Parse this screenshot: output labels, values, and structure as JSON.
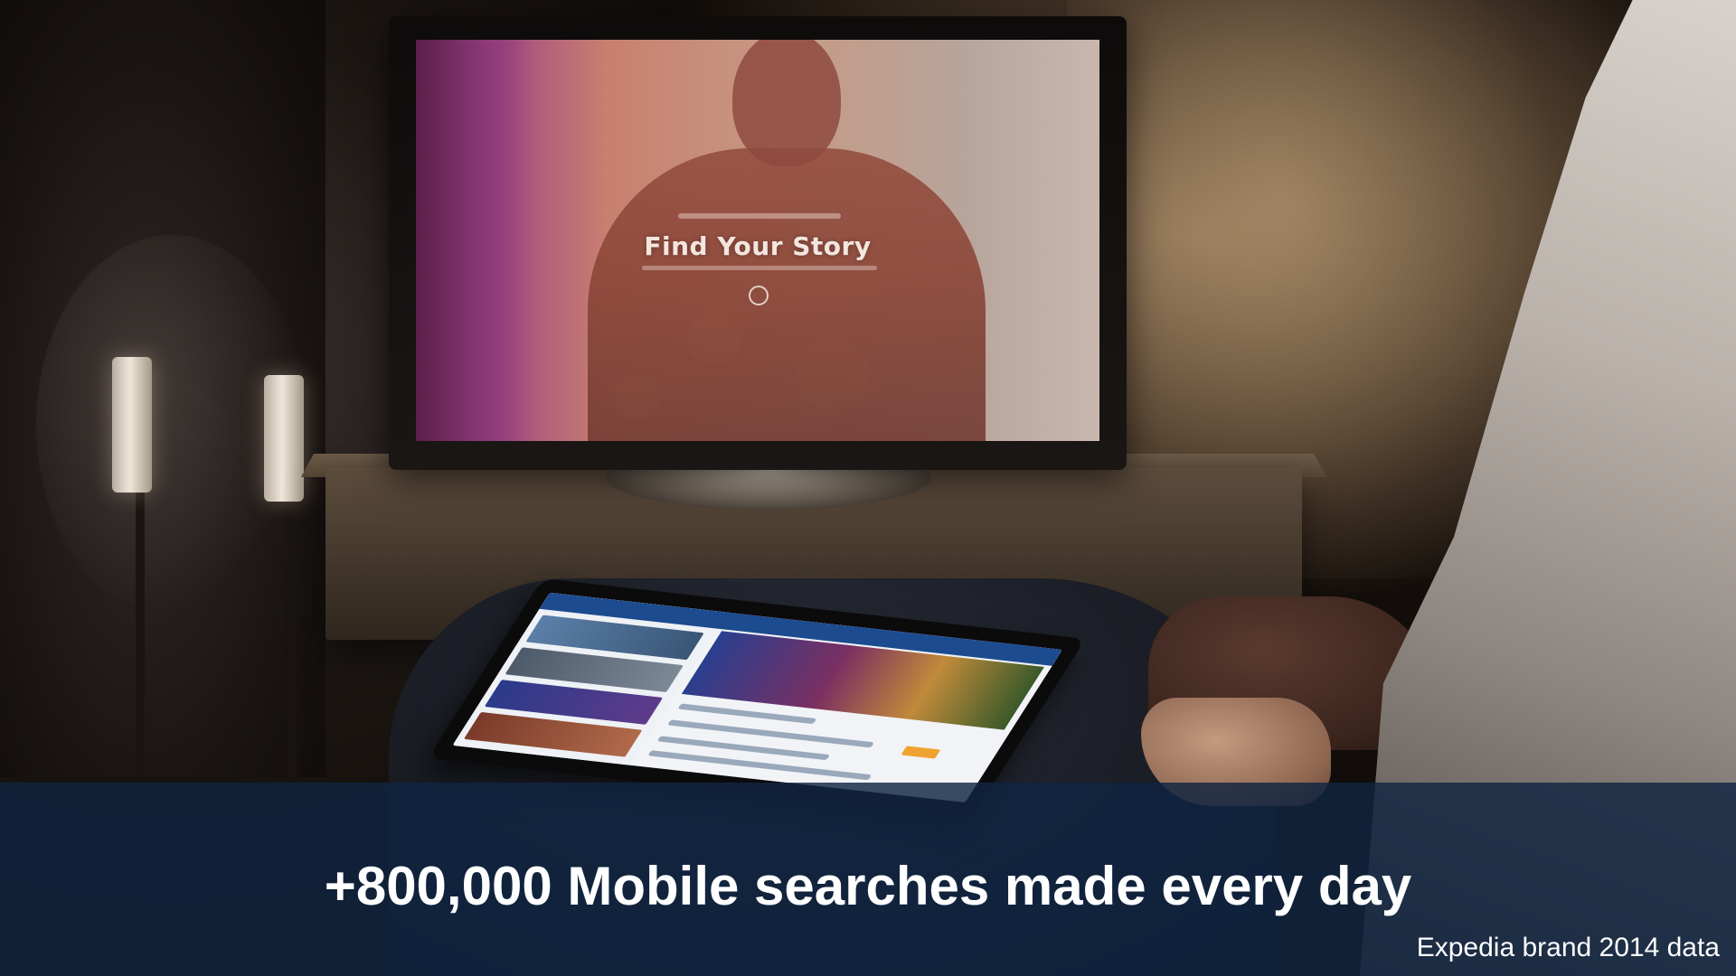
{
  "tv": {
    "screen_title": "Find Your Story"
  },
  "banner": {
    "headline": "+800,000 Mobile searches made every day",
    "source": "Expedia brand 2014 data"
  }
}
